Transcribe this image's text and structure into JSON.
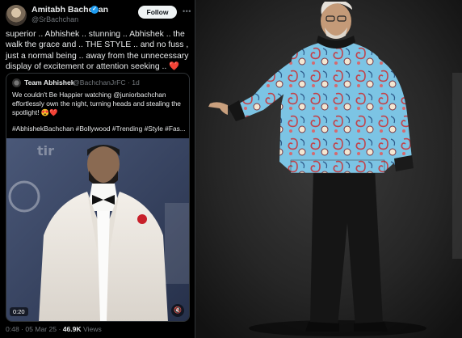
{
  "tweet": {
    "author_name": "Amitabh Bachchan",
    "verified_glyph": "✓",
    "author_handle": "@SrBachchan",
    "follow_label": "Follow",
    "more_glyph": "•••",
    "text": "superior .. Abhishek .. stunning .. Abhishek .. the walk the grace and .. THE STYLE .. and no fuss , just a normal  being  .. away from the unnecessary display of excitement or attention seeking ..",
    "text_emoji": "❤️",
    "quote": {
      "author": "Team Abhishek",
      "meta": "@BachchanJrFC · 1d",
      "text": "We couldn't Be Happier watching @juniorbachchan effortlessly own the night, turning heads and stealing the spotlight! 😍❤️",
      "hashtags": "#AbhishekBachchan #Bollywood #Trending #Style #Fas...",
      "video": {
        "duration": "0:20",
        "mute_glyph": "🔇"
      }
    },
    "footer": {
      "time_date": "0:48 · 05 Mar 25 ·",
      "views_count": "46.9K",
      "views_label": "Views"
    }
  },
  "colors": {
    "background": "#000000",
    "text_primary": "#e7e9ea",
    "text_secondary": "#71767b",
    "border": "#2f3336",
    "verified": "#1d9bf0",
    "heart": "#f4212e",
    "follow_bg": "#eff3f4"
  },
  "icons": {
    "verified": "verified-badge-icon",
    "more": "more-options-icon",
    "mute": "volume-muted-icon"
  }
}
